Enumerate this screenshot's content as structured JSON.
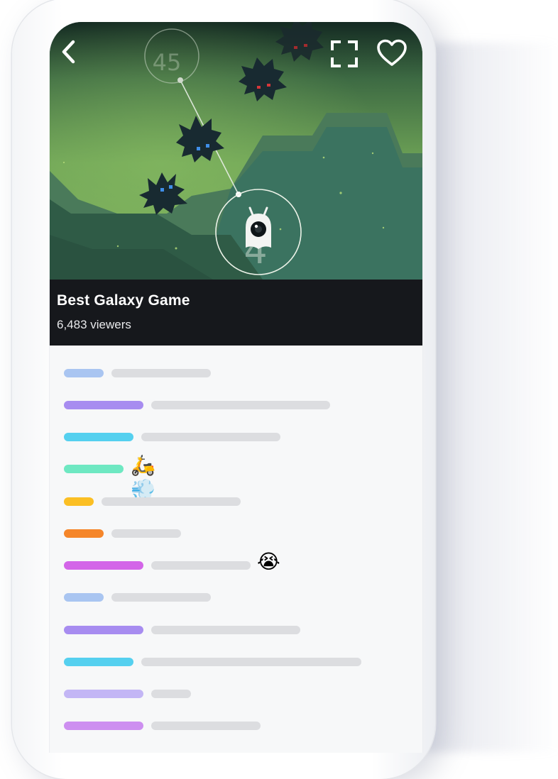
{
  "stream": {
    "title": "Best Galaxy Game",
    "viewers": "6,483 viewers"
  },
  "game_hud": {
    "top_counter": "45",
    "player_counter": "4"
  },
  "icons": {
    "back": "chevron-left-icon",
    "fullscreen": "fullscreen-icon",
    "favorite": "heart-icon"
  },
  "colors": {
    "hud_bar": "#16181c",
    "chat_bg": "#f7f8f9",
    "message_placeholder": "#dcdde0"
  },
  "chat_messages": [
    {
      "name_color": "#a9c5f1",
      "emoji": ""
    },
    {
      "name_color": "#a78cf0",
      "emoji": ""
    },
    {
      "name_color": "#55d0ef",
      "emoji": ""
    },
    {
      "name_color": "#6ee8c2",
      "emoji": "🛵💨"
    },
    {
      "name_color": "#fbbf24",
      "emoji": ""
    },
    {
      "name_color": "#f5862a",
      "emoji": ""
    },
    {
      "name_color": "#d365e8",
      "emoji": "😭"
    },
    {
      "name_color": "#a9c5f1",
      "emoji": ""
    },
    {
      "name_color": "#a78cf0",
      "emoji": ""
    },
    {
      "name_color": "#55d0ef",
      "emoji": ""
    },
    {
      "name_color": "#c3b6f5",
      "emoji": ""
    },
    {
      "name_color": "#cd8ff0",
      "emoji": ""
    }
  ]
}
